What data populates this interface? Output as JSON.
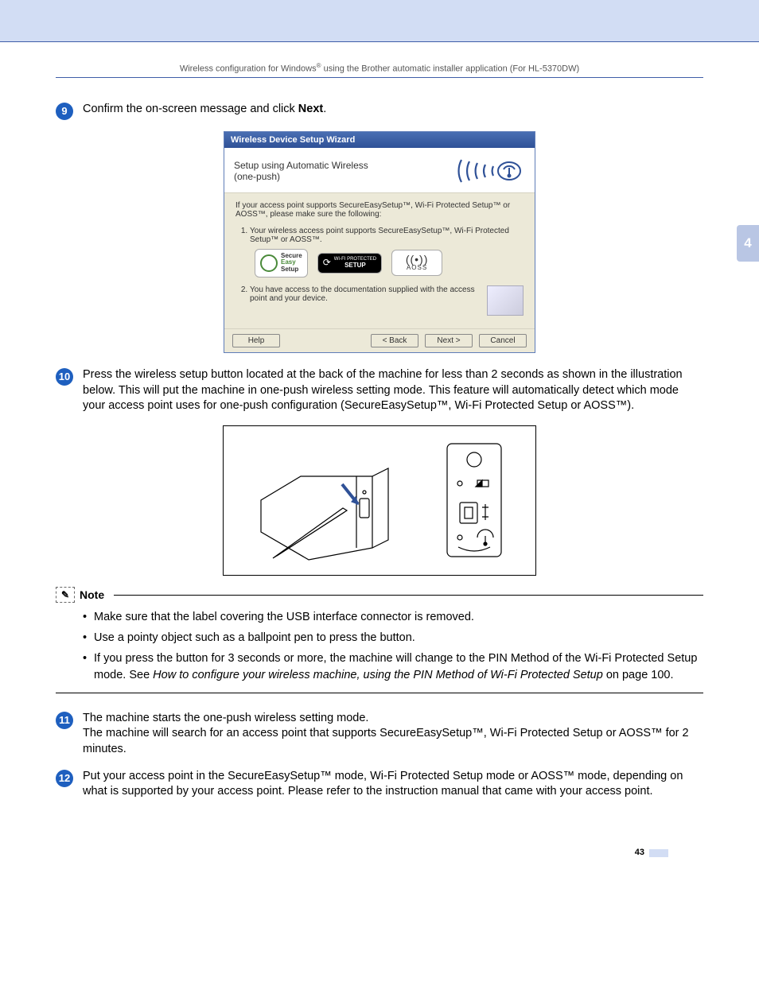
{
  "running_head": {
    "before_sup": "Wireless configuration for Windows",
    "sup": "®",
    "after_sup": " using the Brother automatic installer application (For HL-5370DW)"
  },
  "chapter_tab": "4",
  "steps": {
    "s9": {
      "num": "9",
      "text_before_bold": "Confirm the on-screen message and click ",
      "bold": "Next",
      "text_after_bold": "."
    },
    "s10": {
      "num": "10",
      "text": "Press the wireless setup button located at the back of the machine for less than 2 seconds as shown in the illustration below. This will put the machine in one-push wireless setting mode. This feature will automatically detect which mode your access point uses for one-push configuration (SecureEasySetup™, Wi-Fi Protected Setup or AOSS™)."
    },
    "s11": {
      "num": "11",
      "line1": "The machine starts the one-push wireless setting mode.",
      "line2": "The machine will search for an access point that supports SecureEasySetup™, Wi-Fi Protected Setup or AOSS™ for 2 minutes."
    },
    "s12": {
      "num": "12",
      "text": "Put your access point in the SecureEasySetup™ mode, Wi-Fi Protected Setup mode or AOSS™ mode, depending on what is supported by your access point. Please refer to the instruction manual that came with your access point."
    }
  },
  "wizard": {
    "title": "Wireless Device Setup Wizard",
    "header_line1": "Setup using Automatic Wireless",
    "header_line2": "(one-push)",
    "intro": "If your access point supports SecureEasySetup™, Wi-Fi Protected Setup™ or AOSS™, please make sure the following:",
    "item1": "Your wireless access point supports SecureEasySetup™, Wi-Fi Protected Setup™ or AOSS™.",
    "item2": "You have access to the documentation supplied with the access point and your device.",
    "logos": {
      "ses_line1": "Secure",
      "ses_line2": "Easy",
      "ses_line3": "Setup",
      "wps_line1": "WI-FI PROTECTED",
      "wps_line2": "SETUP",
      "aoss": "AOSS"
    },
    "buttons": {
      "help": "Help",
      "back": "< Back",
      "next": "Next >",
      "cancel": "Cancel"
    }
  },
  "note": {
    "label": "Note",
    "items": [
      {
        "text": "Make sure that the label covering the USB interface connector is removed."
      },
      {
        "text": "Use a pointy object such as a ballpoint pen to press the button."
      },
      {
        "text_before_italic": "If you press the button for 3 seconds or more, the machine will change to the PIN Method of the Wi-Fi Protected Setup mode. See ",
        "italic": "How to configure your wireless machine, using the PIN Method of Wi-Fi Protected Setup",
        "text_after_italic": " on page 100."
      }
    ]
  },
  "page_number": "43"
}
